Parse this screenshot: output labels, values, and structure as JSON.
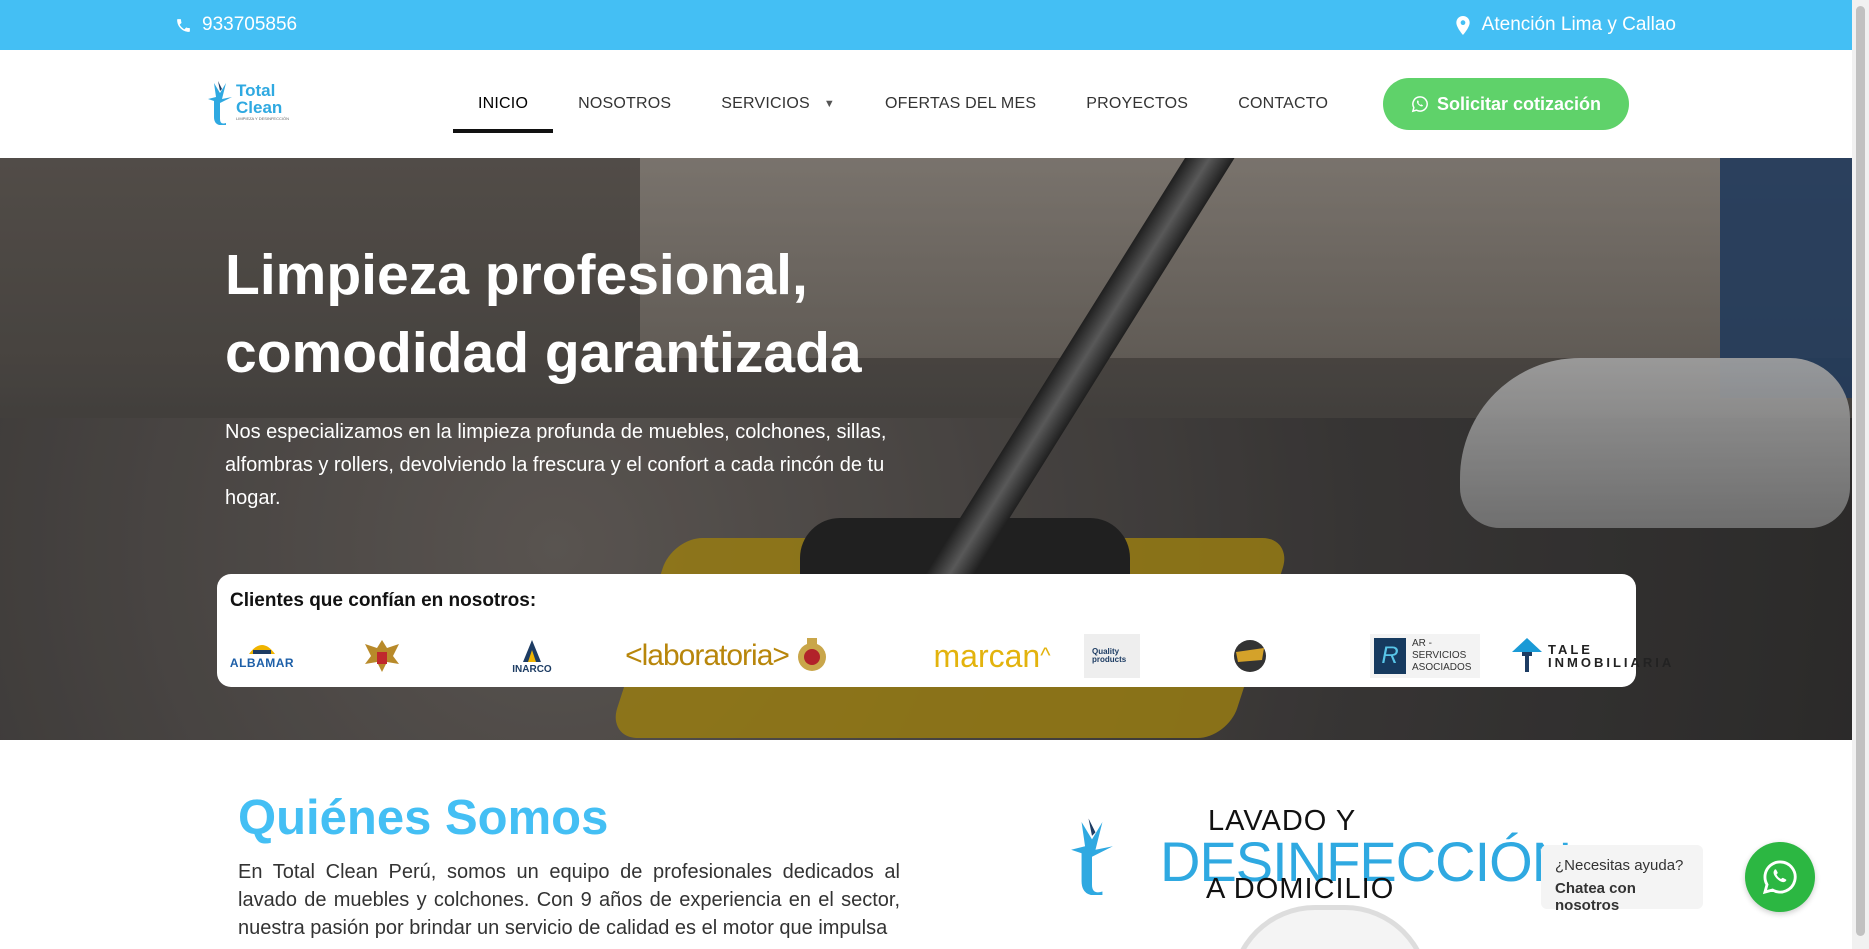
{
  "topbar": {
    "phone": "933705856",
    "location": "Atención Lima y Callao"
  },
  "brand": {
    "name_line1": "Total",
    "name_line2": "Clean",
    "tagline": "LIMPIEZA Y DESINFECCIÓN"
  },
  "nav": {
    "items": [
      "INICIO",
      "NOSOTROS",
      "SERVICIOS",
      "OFERTAS DEL MES",
      "PROYECTOS",
      "CONTACTO"
    ],
    "active": "INICIO",
    "cta_label": "Solicitar cotización"
  },
  "hero": {
    "title_line1": "Limpieza profesional,",
    "title_line2": "comodidad garantizada",
    "description": "Nos especializamos en la limpieza profunda de muebles, colchones, sillas, alfombras y rollers, devolviendo la frescura y el confort a cada rincón de tu hogar."
  },
  "clients": {
    "title": "Clientes que confían en nosotros:",
    "logos": [
      "ALBAMAR",
      "",
      "INARCO",
      "laboratoria",
      "",
      "marcan",
      "Quality products",
      "",
      "AR - SERVICIOS ASOCIADOS",
      "TALE INMOBILIARIA"
    ]
  },
  "about": {
    "title": "Quiénes Somos",
    "text": "En Total Clean Perú, somos un equipo de profesionales dedicados al lavado de muebles y colchones. Con 9 años de experiencia en el sector, nuestra pasión por brindar un servicio de calidad es el motor que impulsa"
  },
  "promo": {
    "line1": "LAVADO Y",
    "line2": "DESINFECCIÓN",
    "line3": "A DOMICILIO"
  },
  "chat": {
    "question": "¿Necesitas ayuda?",
    "action": "Chatea con nosotros"
  },
  "colors": {
    "topbar": "#44bff4",
    "accent": "#44bff4",
    "cta": "#5fd26a",
    "whatsapp": "#2cb742"
  }
}
